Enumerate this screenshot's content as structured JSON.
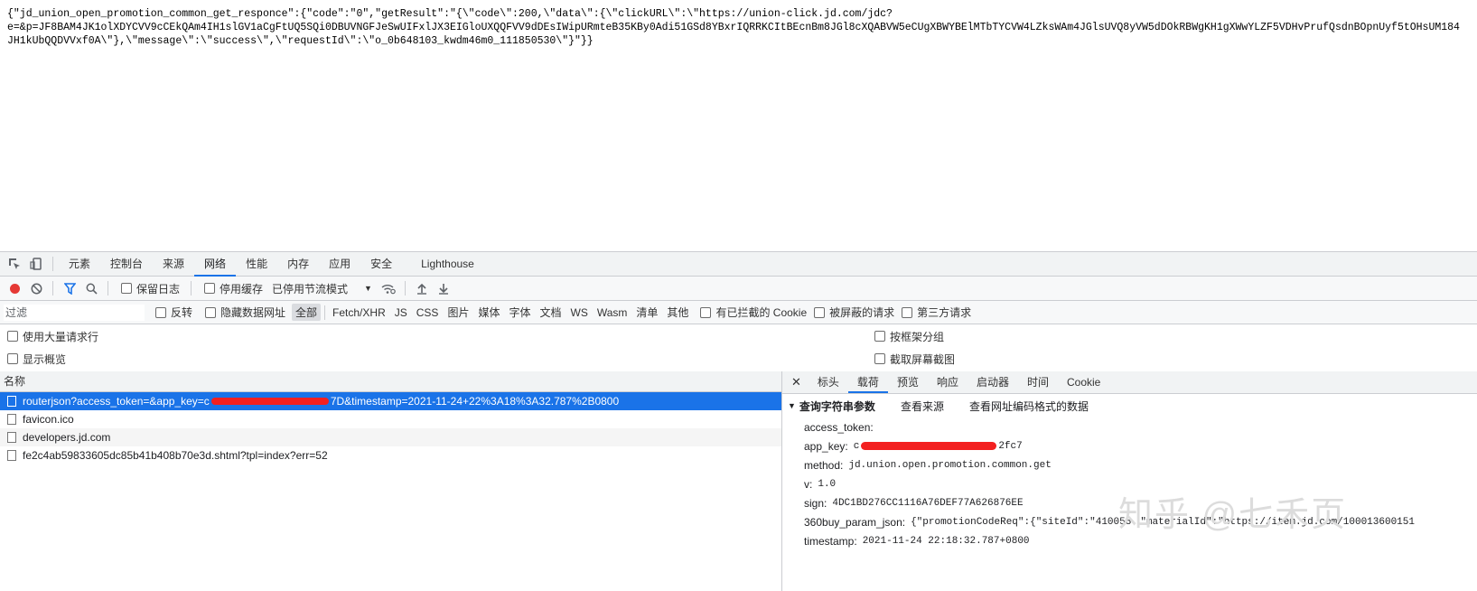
{
  "response_body": "{\"jd_union_open_promotion_common_get_responce\":{\"code\":\"0\",\"getResult\":\"{\\\"code\\\":200,\\\"data\\\":{\\\"clickURL\\\":\\\"https://union-click.jd.com/jdc?\ne=&p=JF8BAM4JK1olXDYCVV9cCEkQAm4IH1slGV1aCgFtUQ5SQi0DBUVNGFJeSwUIFxlJX3EIGloUXQQFVV9dDEsIWipURmteB35KBy0Adi51GSd8YBxrIQRRKCItBEcnBm8JGl8cXQABVW5eCUgXBWYBElMTbTYCVW4LZksWAm4JGlsUVQ8yVW5dDOkRBWgKH1gXWwYLZF5VDHvPrufQsdnBOpnUyf5tOHsUM184\nJH1kUbQQDVVxf0A\\\"},\\\"message\\\":\\\"success\\\",\\\"requestId\\\":\\\"o_0b648103_kwdm46m0_111850530\\\"}\"}}",
  "devtools": {
    "main_tabs": [
      "元素",
      "控制台",
      "来源",
      "网络",
      "性能",
      "内存",
      "应用",
      "安全",
      "Lighthouse"
    ],
    "active_tab": "网络",
    "toolbar": {
      "preserve_log": "保留日志",
      "disable_cache": "停用缓存",
      "throttling": "已停用节流模式"
    },
    "filter": {
      "placeholder": "过滤",
      "invert": "反转",
      "hide_data_urls": "隐藏数据网址",
      "types": [
        "全部",
        "Fetch/XHR",
        "JS",
        "CSS",
        "图片",
        "媒体",
        "字体",
        "文档",
        "WS",
        "Wasm",
        "清单",
        "其他"
      ],
      "active_type": "全部",
      "blocked_cookies": "有已拦截的 Cookie",
      "blocked_requests": "被屏蔽的请求",
      "third_party": "第三方请求"
    },
    "options": {
      "large_rows": "使用大量请求行",
      "overview": "显示概览",
      "group_by_frame": "按框架分组",
      "screenshots": "截取屏幕截图"
    },
    "requests": {
      "header": "名称",
      "rows": [
        {
          "name": "routerjson?access_token=&app_key=c",
          "name_tail": "7D&timestamp=2021-11-24+22%3A18%3A32.787%2B0800"
        },
        {
          "name": "favicon.ico"
        },
        {
          "name": "developers.jd.com"
        },
        {
          "name": "fe2c4ab59833605dc85b41b408b70e3d.shtml?tpl=index?err=52"
        }
      ]
    },
    "detail": {
      "tabs": [
        "标头",
        "载荷",
        "预览",
        "响应",
        "启动器",
        "时间",
        "Cookie"
      ],
      "active_tab": "载荷",
      "section_title": "查询字符串参数",
      "view_source": "查看来源",
      "view_url_encoded": "查看网址编码格式的数据",
      "params": [
        {
          "key": "access_token:",
          "value": ""
        },
        {
          "key": "app_key:",
          "value": "c",
          "value_tail": "2fc7"
        },
        {
          "key": "method:",
          "value": "jd.union.open.promotion.common.get"
        },
        {
          "key": "v:",
          "value": "1.0"
        },
        {
          "key": "sign:",
          "value": "4DC1BD276CC1116A76DEF77A626876EE"
        },
        {
          "key": "360buy_param_json:",
          "value": "{\"promotionCodeReq\":{\"siteId\":\"410058",
          "value_tail": "\"materialId\":\"https://item.jd.com/100013600151"
        },
        {
          "key": "timestamp:",
          "value": "2021-11-24 22:18:32.787+0800"
        }
      ]
    },
    "watermark": "知乎 @七禾页",
    "colors": {
      "accent": "#1a73e8",
      "record": "#e53935",
      "redaction": "#f32020"
    }
  }
}
